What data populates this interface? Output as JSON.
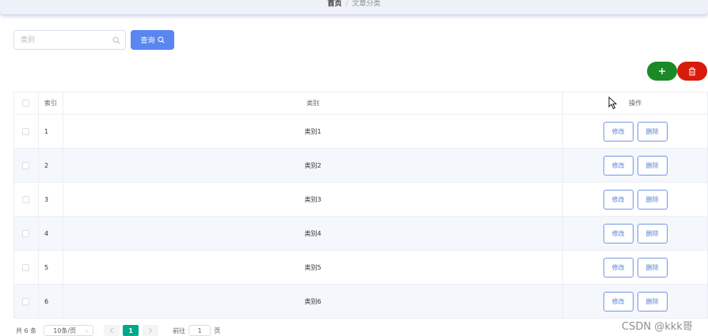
{
  "breadcrumb": {
    "home": "首页",
    "separator": "/",
    "current": "文章分类"
  },
  "search": {
    "placeholder": "类别",
    "value": "",
    "icon": "search-icon"
  },
  "query_button": {
    "label": "查询",
    "icon": "search-icon",
    "color": "#5a86f0"
  },
  "toolbar": {
    "add_icon": "plus-icon",
    "add_color": "#1a8a25",
    "delete_icon": "trash-icon",
    "delete_color": "#d81b0c"
  },
  "table": {
    "headers": {
      "index": "索引",
      "category": "类别",
      "actions": "操作"
    },
    "rows": [
      {
        "index": "1",
        "category": "类别1",
        "edit": "修改",
        "delete": "删除"
      },
      {
        "index": "2",
        "category": "类别2",
        "edit": "修改",
        "delete": "删除"
      },
      {
        "index": "3",
        "category": "类别3",
        "edit": "修改",
        "delete": "删除"
      },
      {
        "index": "4",
        "category": "类别4",
        "edit": "修改",
        "delete": "删除"
      },
      {
        "index": "5",
        "category": "类别5",
        "edit": "修改",
        "delete": "删除"
      },
      {
        "index": "6",
        "category": "类别6",
        "edit": "修改",
        "delete": "删除"
      }
    ]
  },
  "pagination": {
    "total_text": "共 6 条",
    "page_size": "10条/页",
    "prev_icon": "chevron-left-icon",
    "current_page": "1",
    "next_icon": "chevron-right-icon",
    "goto_label": "前往",
    "goto_value": "1",
    "page_suffix": "页",
    "accent": "#00a88a"
  },
  "watermark": "CSDN @kkk哥"
}
